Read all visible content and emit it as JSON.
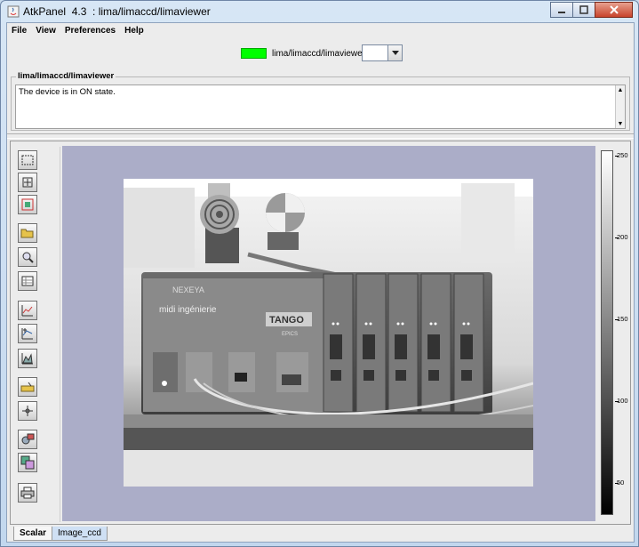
{
  "window": {
    "title": "AtkPanel  4.3  : lima/limaccd/limaviewer",
    "minimize_icon": "minimize-icon",
    "maximize_icon": "maximize-icon",
    "close_icon": "close-icon"
  },
  "menubar": {
    "items": [
      "File",
      "View",
      "Preferences",
      "Help"
    ]
  },
  "device": {
    "name": "lima/limaccd/limaviewer",
    "state_color": "#00ff00",
    "combo_value": ""
  },
  "status": {
    "legend": "lima/limaccd/limaviewer",
    "text": "The device is in ON state."
  },
  "viewer": {
    "toolbar_icons": [
      "selection-rect-icon",
      "crosshair-icon",
      "roi-icon",
      "open-file-icon",
      "zoom-icon",
      "table-view-icon",
      "line-profile-icon",
      "multi-profile-icon",
      "histogram-icon",
      "ruler-icon",
      "cursor-icon",
      "settings-icon",
      "snapshot-icon",
      "print-icon"
    ],
    "colorbar_labels": [
      "250",
      "200",
      "150",
      "100",
      "50"
    ],
    "colorbar_colors": [
      "#ffffff",
      "#000000"
    ],
    "canvas_color": "#abadc8",
    "image_subject": "electronics rack photo"
  },
  "tabs": [
    {
      "label": "Scalar",
      "active": true
    },
    {
      "label": "Image_ccd",
      "active": false
    }
  ]
}
